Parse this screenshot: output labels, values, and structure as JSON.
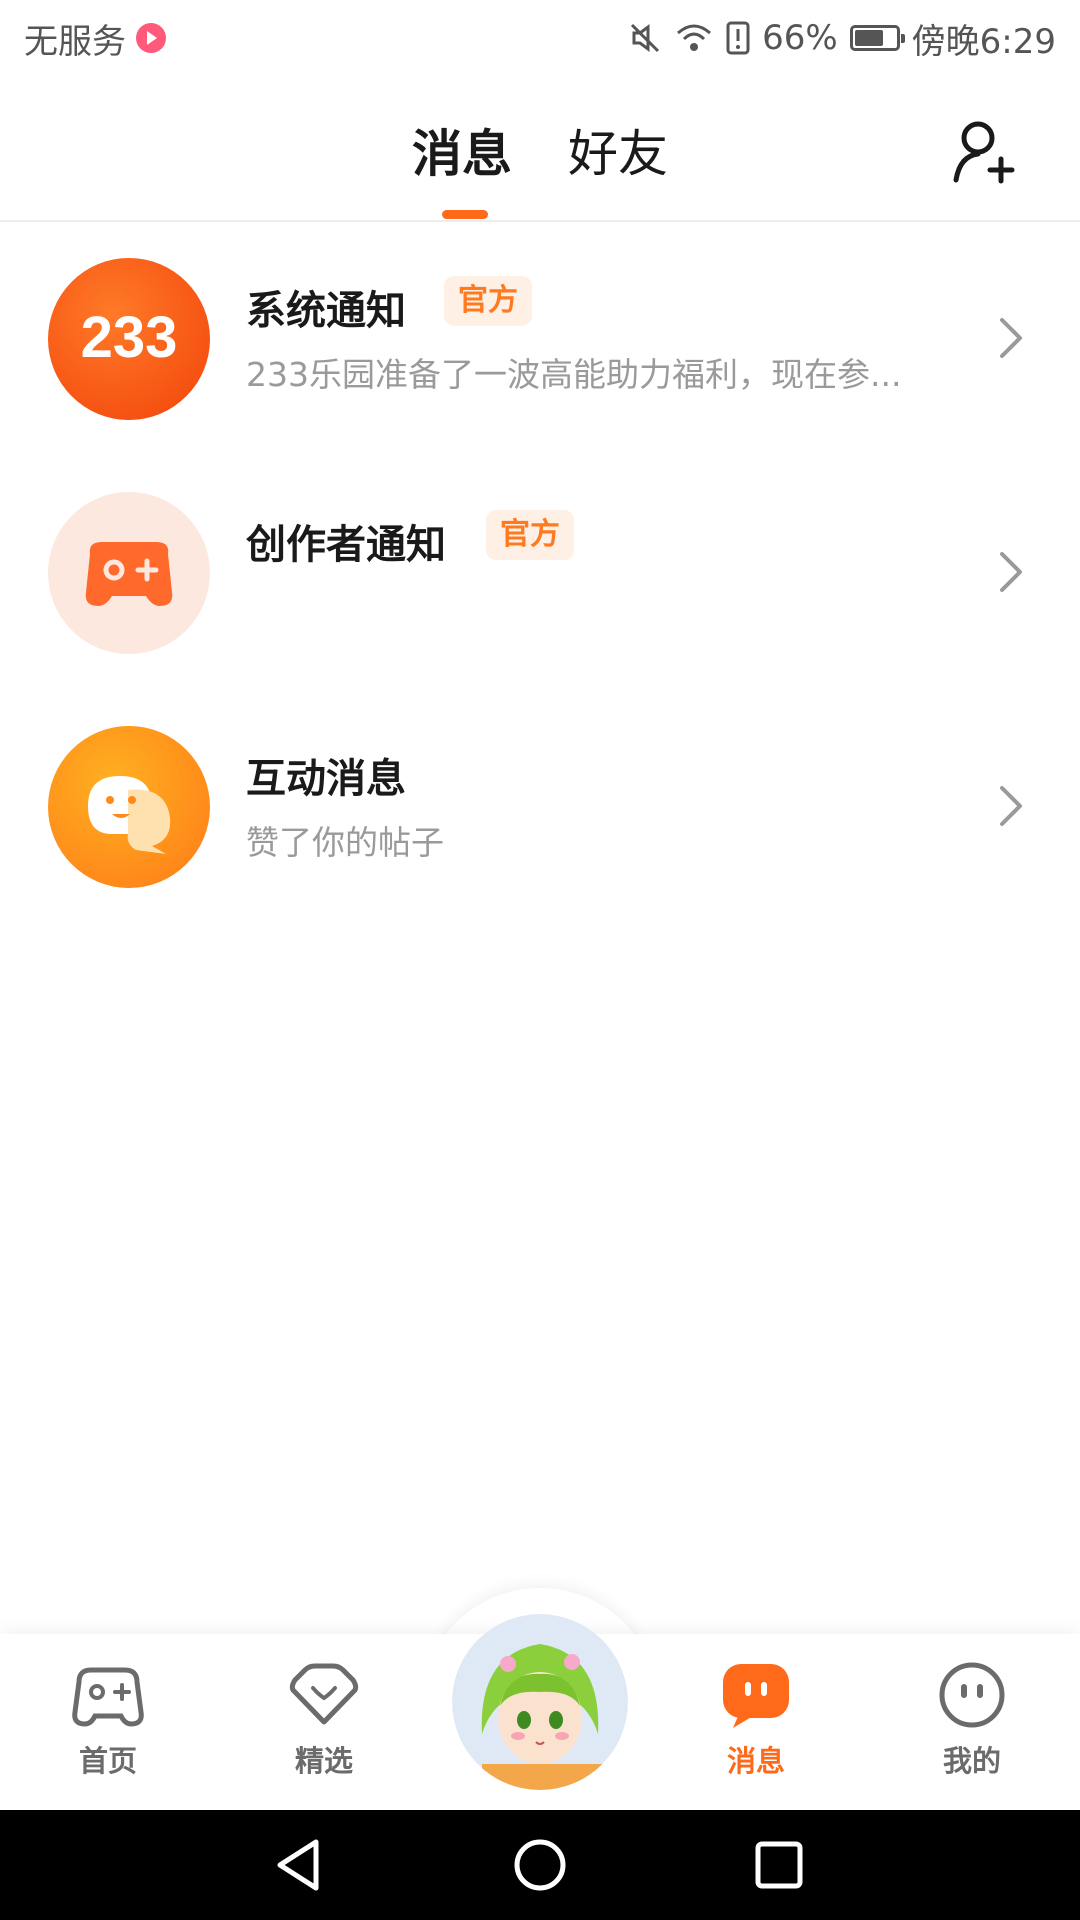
{
  "status_bar": {
    "carrier": "无服务",
    "battery_percent": "66%",
    "time": "傍晚6:29"
  },
  "header": {
    "tabs": [
      {
        "label": "消息",
        "active": true
      },
      {
        "label": "好友",
        "active": false
      }
    ],
    "add_friend_icon": "add-user-icon"
  },
  "messages": [
    {
      "title": "系统通知",
      "badge": "官方",
      "preview": "233乐园准备了一波高能助力福利，现在参...",
      "avatar_text": "233"
    },
    {
      "title": "创作者通知",
      "badge": "官方",
      "preview": ""
    },
    {
      "title": "互动消息",
      "badge": "",
      "preview": "赞了你的帖子"
    }
  ],
  "bottom_nav": {
    "items": [
      {
        "label": "首页",
        "icon": "gamepad-icon",
        "active": false
      },
      {
        "label": "精选",
        "icon": "heart-diamond-icon",
        "active": false
      },
      {
        "label": "消息",
        "icon": "chat-bubble-icon",
        "active": true
      },
      {
        "label": "我的",
        "icon": "face-icon",
        "active": false
      }
    ]
  },
  "colors": {
    "accent": "#ff6a1a",
    "badge_bg": "#fff0e5",
    "text_secondary": "#9a9a9a"
  }
}
